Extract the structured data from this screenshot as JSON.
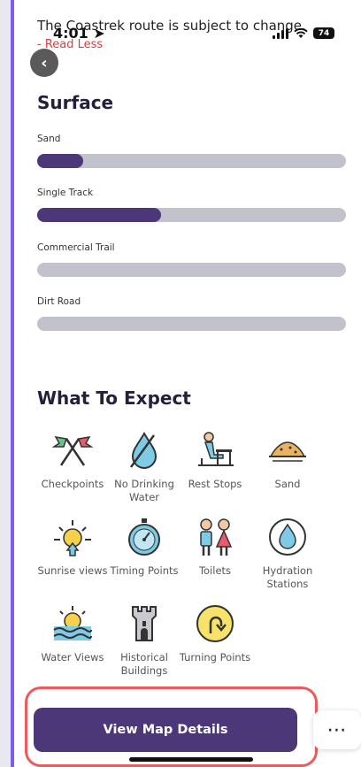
{
  "status_bar": {
    "time": "4:01",
    "battery": "74"
  },
  "notice": {
    "text": "The Coastrek route is subject to change.",
    "read_less": "- Read Less"
  },
  "surface": {
    "title": "Surface",
    "items": [
      {
        "label": "Sand",
        "percent": 15
      },
      {
        "label": "Single Track",
        "percent": 40
      },
      {
        "label": "Commercial Trail",
        "percent": 0
      },
      {
        "label": "Dirt Road",
        "percent": 0
      }
    ]
  },
  "expect": {
    "title": "What To Expect",
    "items": [
      {
        "label": "Checkpoints",
        "icon": "checkpoint-flags-icon"
      },
      {
        "label": "No Drinking Water",
        "icon": "no-drinking-water-icon"
      },
      {
        "label": "Rest Stops",
        "icon": "rest-stop-bench-icon"
      },
      {
        "label": "Sand",
        "icon": "sand-icon"
      },
      {
        "label": "Sunrise views",
        "icon": "sunrise-icon"
      },
      {
        "label": "Timing Points",
        "icon": "stopwatch-icon"
      },
      {
        "label": "Toilets",
        "icon": "toilets-icon"
      },
      {
        "label": "Hydration Stations",
        "icon": "water-drop-icon"
      },
      {
        "label": "Water Views",
        "icon": "water-view-icon"
      },
      {
        "label": "Historical Buildings",
        "icon": "castle-tower-icon"
      },
      {
        "label": "Turning Points",
        "icon": "turn-arrow-icon"
      }
    ]
  },
  "cta": {
    "label": "View Map Details",
    "more": "⋯"
  },
  "colors": {
    "accent": "#4c3778",
    "track": "#c2c2cc",
    "frame": "#7c5bf2",
    "highlight": "#ee5a5a",
    "read_less": "#e33838"
  }
}
